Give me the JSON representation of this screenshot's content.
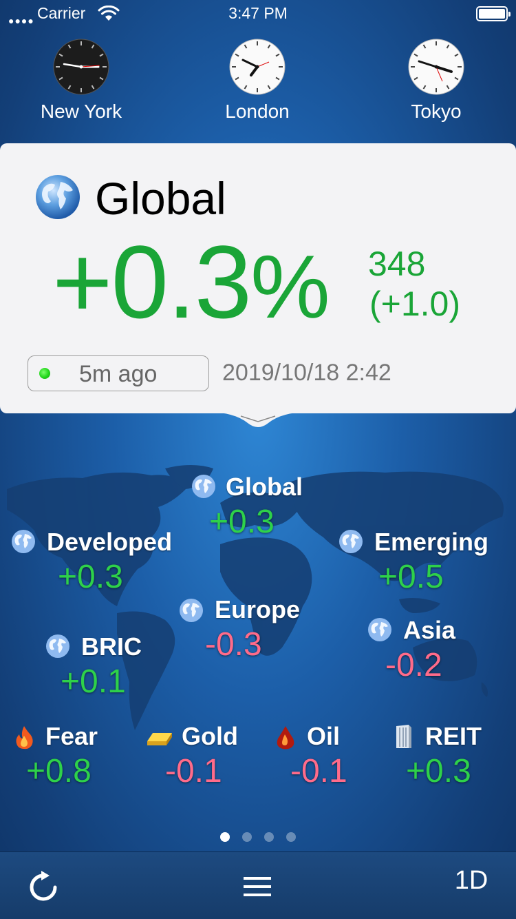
{
  "status_bar": {
    "carrier": "Carrier",
    "time": "3:47 PM"
  },
  "clocks": [
    {
      "city": "New York",
      "theme": "dark"
    },
    {
      "city": "London",
      "theme": "light"
    },
    {
      "city": "Tokyo",
      "theme": "light"
    }
  ],
  "card": {
    "title": "Global",
    "percent_value": "+0.3",
    "percent_sign": "%",
    "index_value": "348",
    "index_change": "(+1.0)",
    "updated_ago": "5m ago",
    "updated_at": "2019/10/18 2:42",
    "up_color": "#1aa537"
  },
  "regions": {
    "global": {
      "name": "Global",
      "value": "+0.3"
    },
    "developed": {
      "name": "Developed",
      "value": "+0.3"
    },
    "emerging": {
      "name": "Emerging",
      "value": "+0.5"
    },
    "europe": {
      "name": "Europe",
      "value": "-0.3"
    },
    "bric": {
      "name": "BRIC",
      "value": "+0.1"
    },
    "asia": {
      "name": "Asia",
      "value": "-0.2"
    },
    "fear": {
      "name": "Fear",
      "value": "+0.8",
      "icon": "flame-icon"
    },
    "gold": {
      "name": "Gold",
      "value": "-0.1",
      "icon": "gold-bar-icon"
    },
    "oil": {
      "name": "Oil",
      "value": "-0.1",
      "icon": "oil-drop-icon"
    },
    "reit": {
      "name": "REIT",
      "value": "+0.3",
      "icon": "building-icon"
    }
  },
  "colors": {
    "positive": "#2ed14a",
    "negative": "#ff6b8a"
  },
  "pager": {
    "pages": 4,
    "current": 1
  },
  "toolbar": {
    "range_label": "1D"
  }
}
